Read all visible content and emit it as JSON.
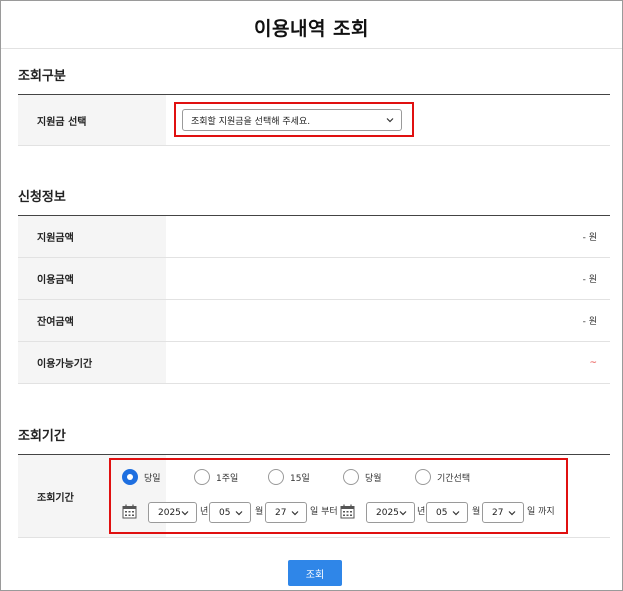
{
  "page": {
    "title": "이용내역 조회"
  },
  "search_type": {
    "heading": "조회구분",
    "fund_label": "지원금 선택",
    "fund_placeholder": "조회할 지원금을 선택해 주세요."
  },
  "application": {
    "heading": "신청정보",
    "rows": [
      {
        "label": "지원금액",
        "value": "- 원"
      },
      {
        "label": "이용금액",
        "value": "- 원"
      },
      {
        "label": "잔여금액",
        "value": "- 원"
      },
      {
        "label": "이용가능기간",
        "value": "~"
      }
    ]
  },
  "period": {
    "heading": "조회기간",
    "label": "조회기간",
    "options": [
      {
        "label": "당일",
        "selected": true
      },
      {
        "label": "1주일",
        "selected": false
      },
      {
        "label": "15일",
        "selected": false
      },
      {
        "label": "당월",
        "selected": false
      },
      {
        "label": "기간선택",
        "selected": false
      }
    ],
    "start": {
      "year": "2025",
      "month": "05",
      "day": "27"
    },
    "end": {
      "year": "2025",
      "month": "05",
      "day": "27"
    },
    "year_suffix": "년",
    "month_suffix": "월",
    "from_suffix": "일 부터",
    "to_suffix": "일 까지"
  },
  "search_button": "조회",
  "colors": {
    "primary": "#2f86e8",
    "highlight": "#e01010",
    "accent_red": "#e53935"
  }
}
